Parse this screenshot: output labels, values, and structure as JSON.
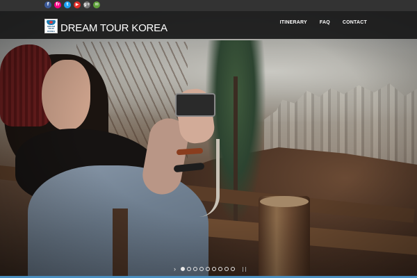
{
  "social": {
    "icons": [
      {
        "name": "facebook-icon",
        "glyph": "f",
        "color": "#3b5998"
      },
      {
        "name": "flickr-icon",
        "glyph": "fr",
        "color": "#ff0084"
      },
      {
        "name": "twitter-icon",
        "glyph": "t",
        "color": "#1da1f2"
      },
      {
        "name": "youtube-icon",
        "glyph": "▶",
        "color": "#e52d27"
      },
      {
        "name": "google-plus-icon",
        "glyph": "g+",
        "color": "#777777"
      },
      {
        "name": "email-icon",
        "glyph": "✉",
        "color": "#5fa13a"
      }
    ]
  },
  "header": {
    "logo_text": "DREAM TOUR KOREA",
    "brand_part1": "DREAM TOUR",
    "brand_part2": "KOREA",
    "nav": [
      {
        "label": "ITINERARY"
      },
      {
        "label": "FAQ"
      },
      {
        "label": "CONTACT"
      }
    ]
  },
  "slider": {
    "prev_glyph": "›",
    "slide_count": 9,
    "active_index": 0
  },
  "colors": {
    "accent": "#4a8fc0",
    "topbar": "#333333",
    "header": "#181818"
  }
}
